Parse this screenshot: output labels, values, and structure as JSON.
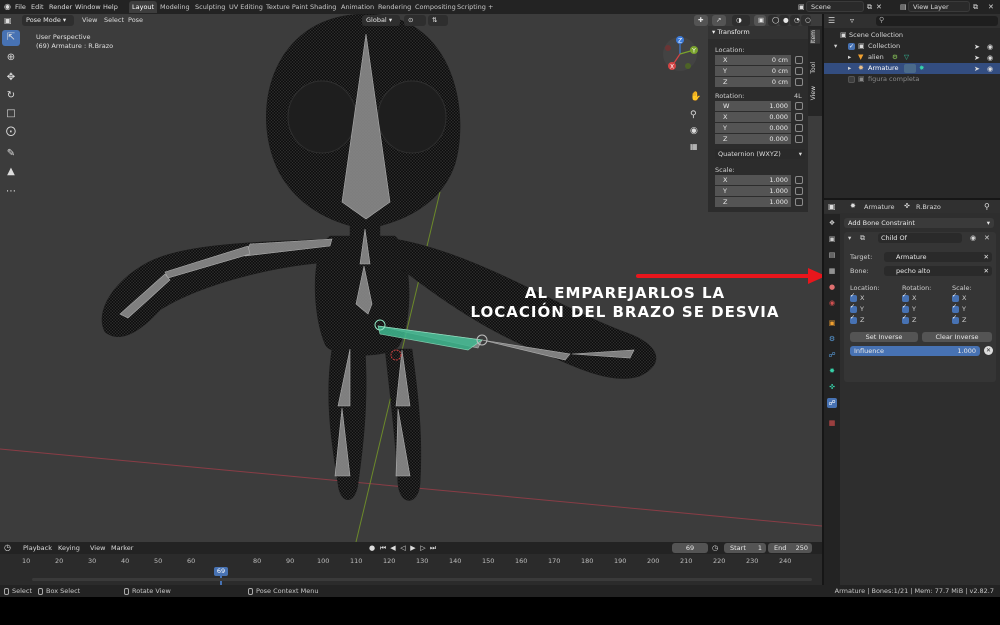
{
  "top_menu": {
    "items": [
      "File",
      "Edit",
      "Render",
      "Window",
      "Help"
    ],
    "tabs": [
      "Layout",
      "Modeling",
      "Sculpting",
      "UV Editing",
      "Texture Paint",
      "Shading",
      "Animation",
      "Rendering",
      "Compositing",
      "Scripting",
      "+"
    ],
    "active_tab": "Layout",
    "scene": "Scene",
    "view_layer": "View Layer"
  },
  "viewport": {
    "mode": "Pose Mode",
    "menu": [
      "View",
      "Select",
      "Pose"
    ],
    "orientation": "Global",
    "perspective": "User Perspective",
    "object_info": "(69) Armature : R.Brazo",
    "gizmo_axes": [
      "Z",
      "Y",
      "X"
    ]
  },
  "transform_panel": {
    "title": "Transform",
    "location_label": "Location:",
    "location": [
      {
        "axis": "X",
        "value": "0 cm"
      },
      {
        "axis": "Y",
        "value": "0 cm"
      },
      {
        "axis": "Z",
        "value": "0 cm"
      }
    ],
    "rotation_label": "Rotation:",
    "rotation_mode_short": "4L",
    "rotation": [
      {
        "axis": "W",
        "value": "1.000"
      },
      {
        "axis": "X",
        "value": "0.000"
      },
      {
        "axis": "Y",
        "value": "0.000"
      },
      {
        "axis": "Z",
        "value": "0.000"
      }
    ],
    "rotation_mode": "Quaternion (WXYZ)",
    "scale_label": "Scale:",
    "scale": [
      {
        "axis": "X",
        "value": "1.000"
      },
      {
        "axis": "Y",
        "value": "1.000"
      },
      {
        "axis": "Z",
        "value": "1.000"
      }
    ],
    "side_tabs": [
      "Item",
      "Tool",
      "View"
    ]
  },
  "annotation": {
    "line1": "AL EMPAREJARLOS LA",
    "line2": "LOCACIÓN DEL BRAZO SE DESVIA",
    "arrow_color": "#e8161c"
  },
  "timeline": {
    "menu": [
      "Playback",
      "Keying",
      "View",
      "Marker"
    ],
    "current_frame": "69",
    "start_label": "Start",
    "start": "1",
    "end_label": "End",
    "end": "250",
    "ticks": [
      "10",
      "20",
      "30",
      "40",
      "50",
      "60",
      "69",
      "80",
      "90",
      "100",
      "110",
      "120",
      "130",
      "140",
      "150",
      "160",
      "170",
      "180",
      "190",
      "200",
      "210",
      "220",
      "230",
      "240"
    ]
  },
  "status_bar": {
    "select": "Select",
    "box_select": "Box Select",
    "rotate_view": "Rotate View",
    "context_menu": "Pose Context Menu",
    "info": "Armature | Bones:1/21 | Mem: 77.7 MiB | v2.82.7"
  },
  "outliner": {
    "rows": [
      {
        "label": "Scene Collection"
      },
      {
        "label": "Collection"
      },
      {
        "label": "alien"
      },
      {
        "label": "Armature"
      },
      {
        "label": "figura completa"
      }
    ]
  },
  "properties": {
    "breadcrumb_object": "Armature",
    "breadcrumb_bone": "R.Brazo",
    "add_constraint": "Add Bone Constraint",
    "constraint_name": "Child Of",
    "target_label": "Target:",
    "target_value": "Armature",
    "bone_label": "Bone:",
    "bone_value": "pecho alto",
    "location_label": "Location:",
    "rotation_label": "Rotation:",
    "scale_label": "Scale:",
    "axes": [
      "X",
      "Y",
      "Z"
    ],
    "set_inverse": "Set Inverse",
    "clear_inverse": "Clear Inverse",
    "influence_label": "Influence",
    "influence_value": "1.000"
  },
  "colors": {
    "accent": "#4772b3",
    "selected_bone": "#3eb88f"
  }
}
